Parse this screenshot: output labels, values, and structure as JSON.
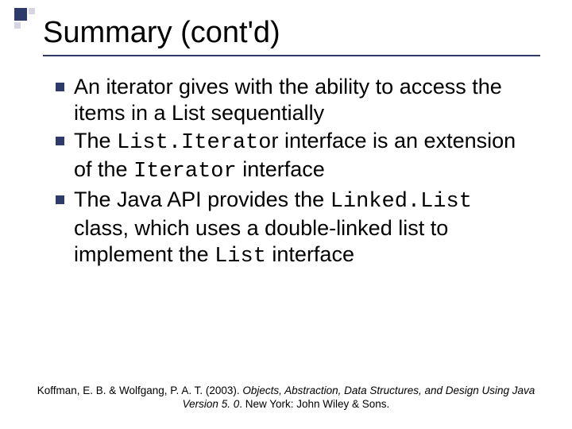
{
  "title": "Summary (cont'd)",
  "bullets": [
    {
      "segments": [
        {
          "text": "An iterator gives with the ability to access the items in a List sequentially",
          "mono": false
        }
      ]
    },
    {
      "segments": [
        {
          "text": "The ",
          "mono": false
        },
        {
          "text": "List.Iterato",
          "mono": true
        },
        {
          "text": "r interface is an extension of the ",
          "mono": false
        },
        {
          "text": "Iterator",
          "mono": true
        },
        {
          "text": " interface",
          "mono": false
        }
      ]
    },
    {
      "segments": [
        {
          "text": "The Java API provides the ",
          "mono": false
        },
        {
          "text": "Linked.List",
          "mono": true
        },
        {
          "text": " class, which uses a double-linked list to implement the ",
          "mono": false
        },
        {
          "text": "List",
          "mono": true
        },
        {
          "text": " interface",
          "mono": false
        }
      ]
    }
  ],
  "footer": {
    "prefix": "Koffman, E. B. & Wolfgang, P. A. T. (2003). ",
    "italic": "Objects, Abstraction, Data Structures, and Design Using Java Version 5. 0",
    "suffix": ". New York: John Wiley & Sons."
  }
}
